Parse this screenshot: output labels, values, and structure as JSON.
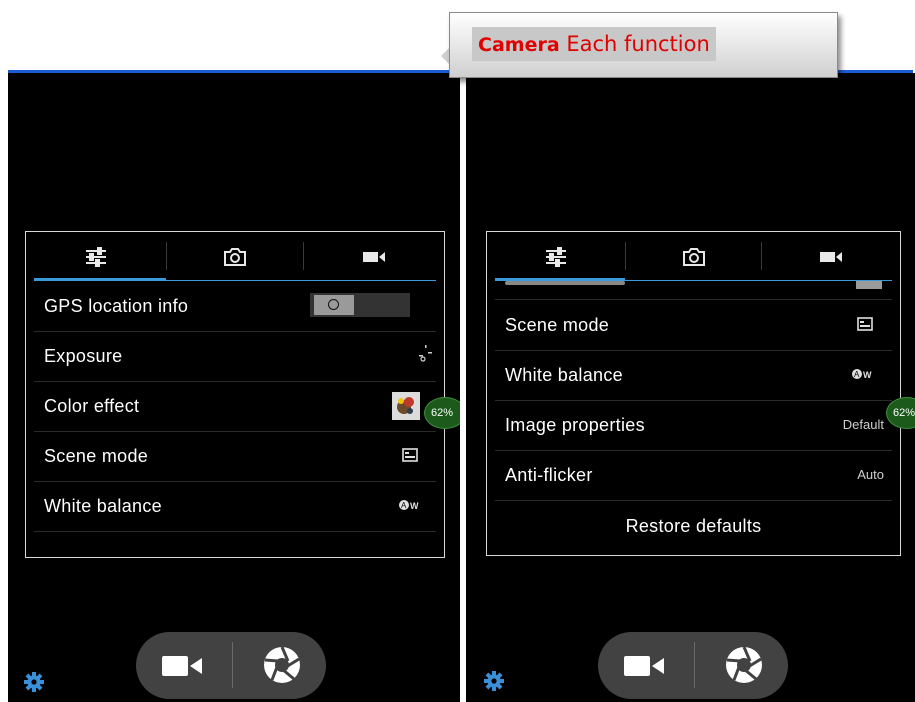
{
  "callout": {
    "title_bold": "Camera",
    "title_rest": "Each function",
    "title_color": "#e00000"
  },
  "tabs": [
    {
      "name": "general-settings",
      "icon": "sliders-icon"
    },
    {
      "name": "photo-settings",
      "icon": "camera-icon"
    },
    {
      "name": "video-settings",
      "icon": "video-camera-icon"
    }
  ],
  "left_panel": {
    "active_tab": 0,
    "rows": [
      {
        "label": "GPS location info",
        "control": "toggle",
        "toggle_on": false
      },
      {
        "label": "Exposure",
        "icon": "exposure-icon"
      },
      {
        "label": "Color effect",
        "icon": "color-effect-thumbnail-icon"
      },
      {
        "label": "Scene mode",
        "icon": "scene-mode-icon"
      },
      {
        "label": "White balance",
        "icon": "auto-white-balance-icon"
      }
    ]
  },
  "right_panel": {
    "active_tab": 0,
    "rows": [
      {
        "label": "Scene mode",
        "icon": "scene-mode-icon"
      },
      {
        "label": "White balance",
        "icon": "auto-white-balance-icon"
      },
      {
        "label": "Image properties",
        "value": "Default"
      },
      {
        "label": "Anti-flicker",
        "value": "Auto"
      }
    ],
    "restore_label": "Restore defaults"
  },
  "zoom_badge": {
    "left": "62%",
    "right": "62%"
  },
  "controls": {
    "settings_icon": "gear-icon",
    "video_icon": "video-camera-icon",
    "shutter_icon": "shutter-icon"
  },
  "colors": {
    "accent": "#3a9ad9",
    "divider": "#1a5bd6",
    "gear": "#3a8fd9",
    "badge": "#1c5a1c"
  }
}
